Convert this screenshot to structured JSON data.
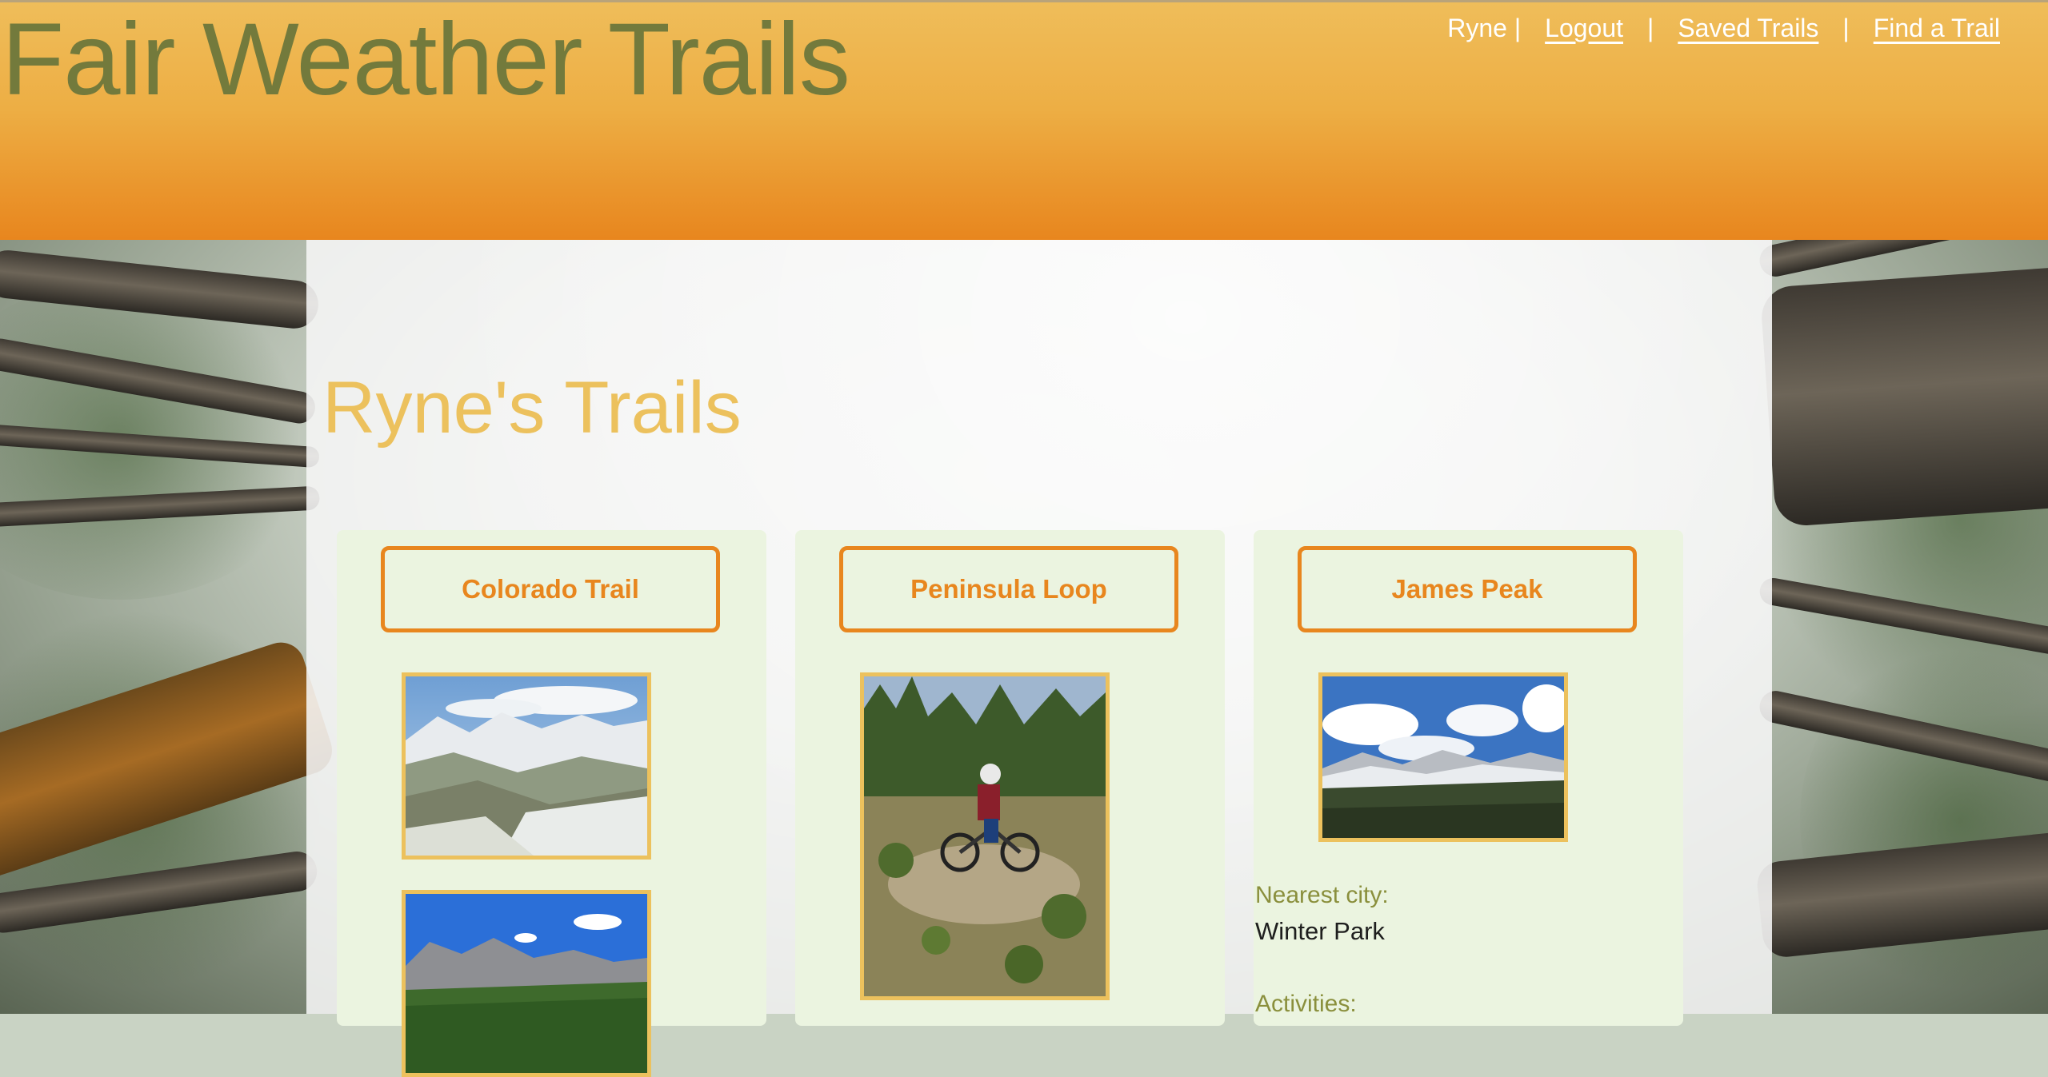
{
  "header": {
    "site_title": "Fair Weather Trails",
    "user": "Ryne |",
    "separator": "|",
    "nav": {
      "logout": "Logout",
      "saved_trails": "Saved Trails",
      "find_trail": "Find a Trail"
    }
  },
  "main": {
    "heading": "Ryne's Trails",
    "trails": [
      {
        "name": "Colorado Trail",
        "photo1": "mountain-snow-photo",
        "photo2": "mountain-forest-photo"
      },
      {
        "name": "Peninsula Loop",
        "photo1": "mountain-biker-photo"
      },
      {
        "name": "James Peak",
        "photo1": "mountain-clouds-photo",
        "nearest_city_label": "Nearest city:",
        "nearest_city": "Winter Park",
        "activities_label": "Activities:"
      }
    ]
  },
  "colors": {
    "header_top": "#efbd5a",
    "header_bottom": "#e8861e",
    "title": "#737a3c",
    "accent": "#e8861e",
    "heading": "#ecc15d",
    "card_bg": "#ebf4e0"
  }
}
